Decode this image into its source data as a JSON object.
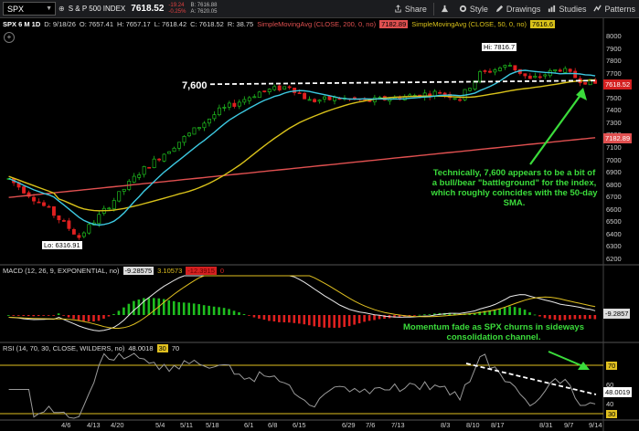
{
  "toolbar": {
    "symbol": "SPX",
    "security_name": "S & P 500 INDEX",
    "last_price": "7618.52",
    "change": "-19.24",
    "change_pct": "-0.25%",
    "bid": "B: 7616.88",
    "ask": "A: 7620.05",
    "share_label": "Share",
    "style_label": "Style",
    "drawings_label": "Drawings",
    "studies_label": "Studies",
    "patterns_label": "Patterns"
  },
  "infobar": {
    "period": "SPX 6 M 1D",
    "date": "D: 9/18/26",
    "open": "O: 7657.41",
    "high": "H: 7657.17",
    "low": "L: 7618.42",
    "close": "C: 7618.52",
    "range": "R: 38.75",
    "sma200_label": "SimpleMovingAvg (CLOSE, 200, 0, no)",
    "sma200_value": "7182.89",
    "sma50_label": "SimpleMovingAvg (CLOSE, 50, 0, no)",
    "sma50_value": "7616.6"
  },
  "price_axis": [
    "8000",
    "7900",
    "7800",
    "7700",
    "7600",
    "7500",
    "7400",
    "7300",
    "7200",
    "7100",
    "7000",
    "6900",
    "6800",
    "6700",
    "6600",
    "6500",
    "6400",
    "6300",
    "6200"
  ],
  "price_tags": {
    "last": "7618.52",
    "sma200": "7182.89"
  },
  "price_labels": {
    "hi": "Hi: 7816.7",
    "lo": "Lo: 6316.91",
    "level": "7,600"
  },
  "macd": {
    "title": "MACD (12, 26, 9, EXPONENTIAL, no)",
    "value": "-9.28575",
    "avg": "3.10573",
    "diff": "-12.3915",
    "zero": "0",
    "tag": "-9.2857"
  },
  "rsi": {
    "title": "RSI (14, 70, 30, CLOSE, WILDERS, no)",
    "value": "48.0018",
    "ob": "30",
    "os": "70",
    "axis": [
      "70",
      "60",
      "40",
      "30"
    ],
    "tag": "48.0019"
  },
  "dates": [
    "4/6",
    "4/13",
    "4/20",
    "5/4",
    "5/11",
    "5/18",
    "6/1",
    "6/8",
    "6/15",
    "6/29",
    "7/6",
    "7/13",
    "8/3",
    "8/10",
    "8/17",
    "8/31",
    "9/7",
    "9/14"
  ],
  "annotations": {
    "price": "Technically, 7,600 appears to be a bit of a bull/bear \"battleground\" for the index, which roughly coincides with the 50-day SMA.",
    "rsi": "Momentum fade as SPX churns in sideways consolidation channel."
  },
  "colors": {
    "up": "#1fbf1f",
    "down": "#e02020",
    "sma50": "#d9c21a",
    "sma200": "#e05050",
    "ema": "#3cc8e0",
    "annotation": "#3bdc3b"
  }
}
